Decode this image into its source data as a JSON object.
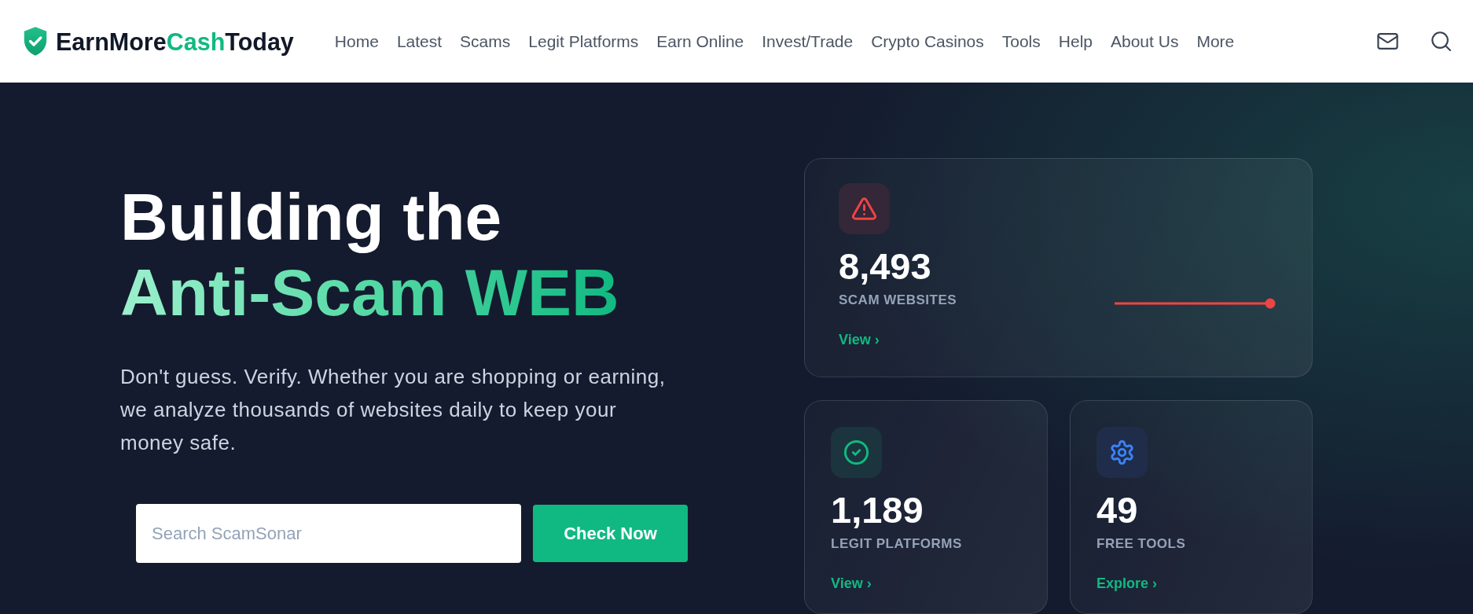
{
  "header": {
    "logo": {
      "text_start": "EarnMore",
      "highlight": "Cash",
      "text_end": "Today"
    },
    "nav": [
      "Home",
      "Latest",
      "Scams",
      "Legit Platforms",
      "Earn Online",
      "Invest/Trade",
      "Crypto Casinos",
      "Tools",
      "Help",
      "About Us",
      "More"
    ]
  },
  "hero": {
    "headline": {
      "line_1": "Building the",
      "highlight": "Anti-Scam WEB"
    },
    "description": "Don't guess. Verify. Whether you are shopping or earning, we analyze thousands of websites daily to keep your money safe.",
    "search": {
      "placeholder": "Search ScamSonar"
    },
    "button": "Check Now"
  },
  "stats": [
    {
      "kind": "featured",
      "color": "#ef4444",
      "value": "8,493",
      "label": "SCAM WEBSITES",
      "link": "View ›"
    },
    {
      "kind": "compact",
      "color": "#10b981",
      "value": "1,189",
      "label": "LEGIT PLATFORMS",
      "link": "View ›"
    },
    {
      "kind": "compact",
      "color": "#3b82f6",
      "value": "49",
      "label": "FREE TOOLS",
      "link": "Explore ›"
    }
  ]
}
